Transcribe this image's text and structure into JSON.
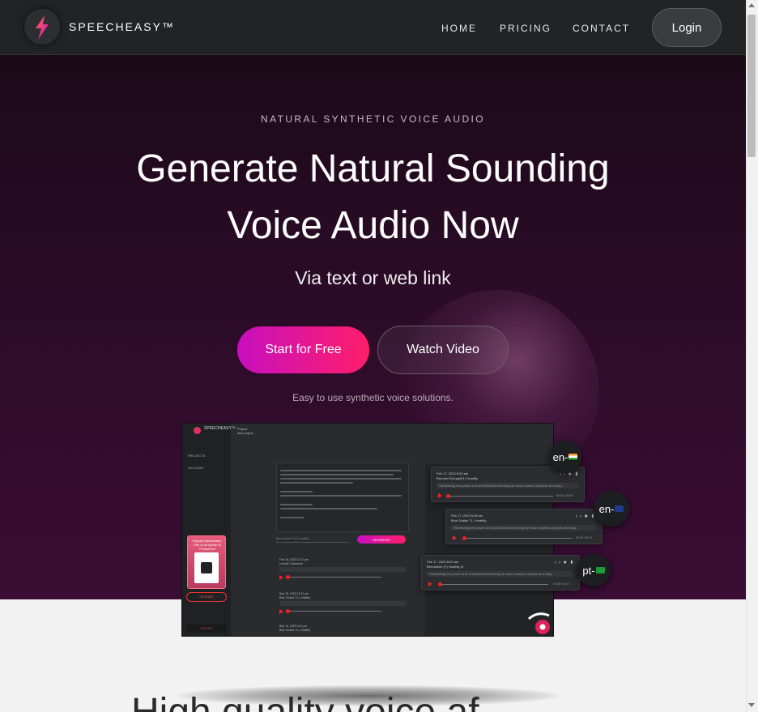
{
  "nav": {
    "brand": "SPEECHEASY™",
    "links": [
      "HOME",
      "PRICING",
      "CONTACT"
    ],
    "login": "Login",
    "logo_icon": "lightning-bolt-icon"
  },
  "hero": {
    "eyebrow": "NATURAL SYNTHETIC VOICE AUDIO",
    "headline_line1": "Generate Natural Sounding",
    "headline_line2": "Voice Audio Now",
    "sub": "Via text or web link",
    "start_label": "Start for Free",
    "video_label": "Watch Video",
    "tagline": "Easy to use synthetic voice solutions."
  },
  "mockup": {
    "brand": "SPEECHEASY™",
    "side_items": [
      "PROJECTS",
      "ACCOUNT"
    ],
    "project_label": "Project",
    "project_name": "test project",
    "card_title": "Enjoying SpeechEasy? Give us an Upvote on ProductHunt",
    "upgrade": "UPGRADE",
    "logout": "LOGOUT",
    "generate": "GENERATE",
    "voice": "Blue Zodiac™ (F) HoaiMy",
    "items": [
      {
        "date": "Feb 15, 2023 12:11 pm",
        "voice": "LeoedE | Neuenen"
      },
      {
        "date": "Sep 15, 2023 12:11 am",
        "voice": "Blue Zodiac TL | HoaiMy"
      },
      {
        "date": "Sep 14, 2023 4:11 pm",
        "voice": "Blue Zodiac TL | HoaiMy"
      }
    ]
  },
  "float_cards": [
    {
      "date": "Feb 17, 2023 8:33 am",
      "voice": "Rendeki Grange(F) | HoaiMy",
      "text": "Harnessing the power of AI and Machine learning we have created a simple and easy...",
      "time": "00:00 / 00:15"
    },
    {
      "date": "Feb 17, 2023 8:28 am",
      "voice": "Blue Zodiac TL | HoaiMy",
      "text": "Harnessing the power of AI and Machine learning we have created a simple and easy...",
      "time": "00:00 / 00:17"
    },
    {
      "date": "Feb 17, 2023 8:29 am",
      "voice": "Bernadette (F) HoaiMy pt",
      "text": "Harnessing the power of AI and Machine learning we have created a simple and easy...",
      "time": "00:00 / 00:17"
    }
  ],
  "langs": [
    {
      "label": "en-",
      "flag_color": "#ff9933"
    },
    {
      "label": "en-",
      "flag_color": "#1f3a8a"
    },
    {
      "label": "pt-",
      "flag_color": "#1f9a3a"
    }
  ],
  "bottom": {
    "heading": "High quality voice af"
  },
  "colors": {
    "accent_from": "#c80fbf",
    "accent_to": "#ff1e6a",
    "hero_bg": "#2a0b26",
    "nav_bg": "#222325"
  }
}
